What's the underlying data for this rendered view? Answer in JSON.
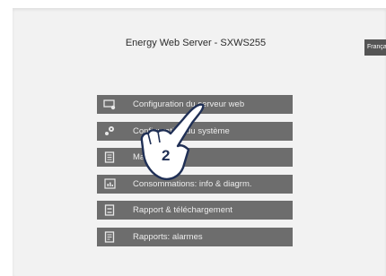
{
  "header": {
    "title": "Energy Web Server - SXWS255",
    "language_label": "Français"
  },
  "menu": {
    "items": [
      {
        "label": "Configuration du serveur web",
        "icon": "screen-settings-icon"
      },
      {
        "label": "Configuration du système",
        "icon": "gears-icon"
      },
      {
        "label": "Maintenance",
        "icon": "document-stack-icon"
      },
      {
        "label": "Consommations: info & diagrm.",
        "icon": "chart-icon"
      },
      {
        "label": "Rapport & téléchargement",
        "icon": "report-download-icon"
      },
      {
        "label": "Rapports: alarmes",
        "icon": "alarm-report-icon"
      }
    ]
  },
  "overlay": {
    "step_number": "2",
    "icon": "pointing-hand-icon"
  }
}
